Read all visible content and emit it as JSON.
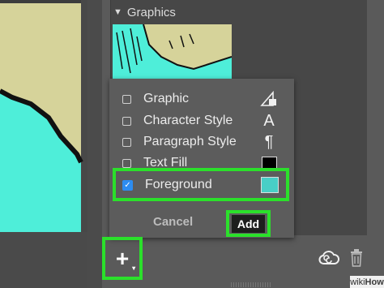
{
  "library": {
    "section_title": "Graphics"
  },
  "menu": {
    "items": [
      {
        "label": "Graphic",
        "checked": false,
        "icon": "graphic-shape-icon"
      },
      {
        "label": "Character Style",
        "checked": false,
        "icon": "character-style-icon"
      },
      {
        "label": "Paragraph Style",
        "checked": false,
        "icon": "pilcrow-icon"
      },
      {
        "label": "Text Fill",
        "checked": false,
        "icon": "black-swatch-icon"
      },
      {
        "label": "Foreground",
        "checked": true,
        "icon": "teal-swatch-icon"
      }
    ],
    "character_style_glyph": "A",
    "paragraph_style_glyph": "¶",
    "cancel_label": "Cancel",
    "add_label": "Add"
  },
  "toolbar": {
    "plus_label": "+"
  },
  "watermark": {
    "text_a": "wiki",
    "text_b": "How"
  },
  "colors": {
    "foreground_swatch": "#48cfc6",
    "text_fill_swatch": "#000000",
    "highlight": "#2be02b",
    "checkbox_checked": "#2d8cf0"
  }
}
